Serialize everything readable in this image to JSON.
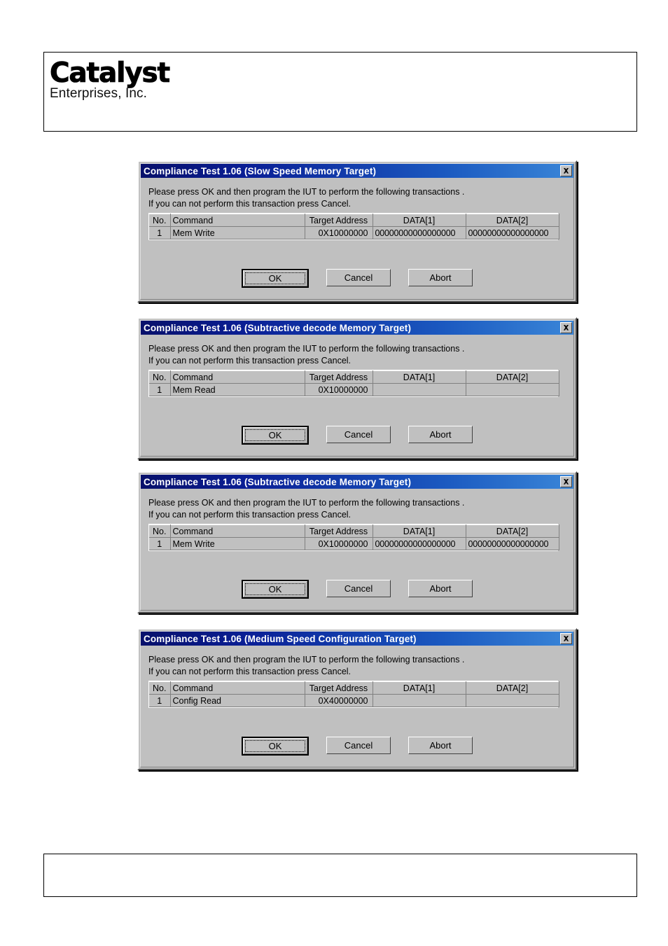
{
  "page": {
    "header": {
      "logo_main": "Catalyst",
      "logo_sub": "Enterprises, Inc."
    },
    "footer": {
      "text": ""
    }
  },
  "dialog_common": {
    "prompt_line_1": "Please press OK and then program the IUT to perform the following transactions .",
    "prompt_line_2": "If you can not perform this transaction press Cancel.",
    "columns": [
      "No.",
      "Command",
      "Target Address",
      "DATA[1]",
      "DATA[2]"
    ],
    "buttons": {
      "ok": "OK",
      "cancel": "Cancel",
      "abort": "Abort"
    },
    "close_icon": "close-icon",
    "accent_title_color": "#0a1f96",
    "data_text_color": "#1818e0",
    "face_color": "#c0c0c0"
  },
  "dialogs": [
    {
      "title": "Compliance Test 1.06 (Slow Speed Memory Target)",
      "row": {
        "no": "1",
        "command": "Mem Write",
        "target_address": "0X10000000",
        "data1": "00000000000000000",
        "data2": "00000000000000000"
      }
    },
    {
      "title": "Compliance Test 1.06 (Subtractive decode Memory Target)",
      "row": {
        "no": "1",
        "command": "Mem Read",
        "target_address": "0X10000000",
        "data1": "",
        "data2": ""
      }
    },
    {
      "title": "Compliance Test 1.06 (Subtractive decode Memory Target)",
      "row": {
        "no": "1",
        "command": "Mem Write",
        "target_address": "0X10000000",
        "data1": "00000000000000000",
        "data2": "00000000000000000"
      }
    },
    {
      "title": "Compliance Test 1.06 (Medium Speed Configuration Target)",
      "row": {
        "no": "1",
        "command": "Config Read",
        "target_address": "0X40000000",
        "data1": "",
        "data2": ""
      }
    }
  ]
}
